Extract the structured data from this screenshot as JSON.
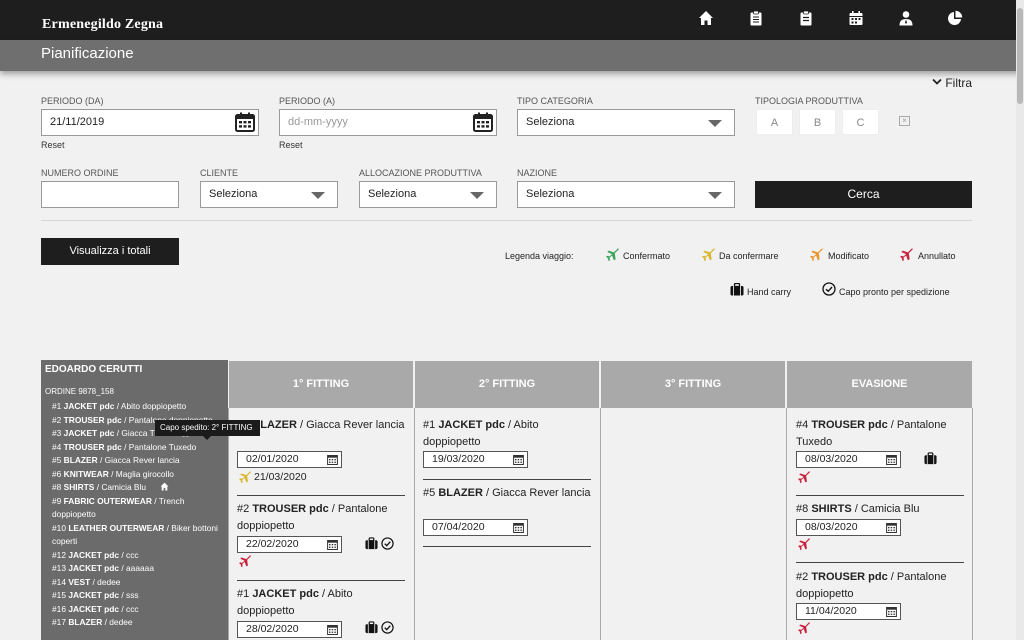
{
  "app": {
    "brand": "Ermenegildo Zegna",
    "page_title": "Pianificazione"
  },
  "nav_icons": [
    "home-icon",
    "clipboard-icon",
    "clipboard-list-icon",
    "calendar-icon",
    "user-icon",
    "pie-chart-icon"
  ],
  "filters": {
    "toggle_label": "Filtra",
    "periodo_da": {
      "label": "PERIODO (DA)",
      "value": "21/11/2019",
      "reset": "Reset"
    },
    "periodo_a": {
      "label": "PERIODO (A)",
      "placeholder": "dd-mm-yyyy",
      "reset": "Reset"
    },
    "tipo_categoria": {
      "label": "TIPO CATEGORIA",
      "value": "Seleziona"
    },
    "tipologia": {
      "label": "TIPOLOGIA PRODUTTIVA",
      "options": [
        "A",
        "B",
        "C"
      ],
      "clear": "×"
    },
    "numero_ordine": {
      "label": "NUMERO ORDINE",
      "value": ""
    },
    "cliente": {
      "label": "CLIENTE",
      "value": "Seleziona"
    },
    "allocazione": {
      "label": "ALLOCAZIONE PRODUTTIVA",
      "value": "Seleziona"
    },
    "nazione": {
      "label": "NAZIONE",
      "value": "Seleziona"
    },
    "search_label": "Cerca"
  },
  "totali_label": "Visualizza i totali",
  "legend": {
    "title": "Legenda viaggio:",
    "items": [
      {
        "label": "Confermato",
        "color": "#3aa35a"
      },
      {
        "label": "Da confermare",
        "color": "#d9b52a"
      },
      {
        "label": "Modificato",
        "color": "#e8962a"
      },
      {
        "label": "Annullato",
        "color": "#c8203a"
      }
    ],
    "hand_carry": "Hand carry",
    "capo_pronto": "Capo pronto per spedizione"
  },
  "client": {
    "name": "EDOARDO CERUTTI",
    "order": "ORDINE 9878_158",
    "items": [
      {
        "code": "#1",
        "name": "JACKET pdc",
        "desc": " / Abito doppiopetto"
      },
      {
        "code": "#2",
        "name": "TROUSER pdc",
        "desc": " / Pantalone doppiopetto"
      },
      {
        "code": "#3",
        "name": "JACKET pdc",
        "desc": " / Giacca Tuxedo"
      },
      {
        "code": "#4",
        "name": "TROUSER pdc",
        "desc": " / Pantalone Tuxedo"
      },
      {
        "code": "#5",
        "name": "BLAZER",
        "desc": " / Giacca Rever lancia"
      },
      {
        "code": "#6",
        "name": "KNITWEAR",
        "desc": " / Maglia girocollo"
      },
      {
        "code": "#8",
        "name": "SHIRTS",
        "desc": " / Camicia Blu"
      },
      {
        "code": "#9",
        "name": "FABRIC OUTERWEAR",
        "desc": " / Trench doppiopetto"
      },
      {
        "code": "#10",
        "name": "LEATHER OUTERWEAR",
        "desc": " / Biker bottoni coperti"
      },
      {
        "code": "#12",
        "name": "JACKET pdc",
        "desc": " / ccc"
      },
      {
        "code": "#13",
        "name": "JACKET pdc",
        "desc": " / aaaaaa"
      },
      {
        "code": "#14",
        "name": "VEST",
        "desc": " / dedee"
      },
      {
        "code": "#15",
        "name": "JACKET pdc",
        "desc": " / sss"
      },
      {
        "code": "#16",
        "name": "JACKET pdc",
        "desc": " / ccc"
      },
      {
        "code": "#17",
        "name": "BLAZER",
        "desc": " / dedee"
      }
    ],
    "tooltip": "Capo spedito: 2° FITTING"
  },
  "columns": [
    {
      "title": "1° FITTING",
      "cards": [
        {
          "code": "#5",
          "name": "BLAZER",
          "desc": " / Giacca Rever lancia",
          "date": "02/01/2020",
          "travel_date": "21/03/2020"
        },
        {
          "code": "#2",
          "name": "TROUSER pdc",
          "desc": " / Pantalone doppiopetto",
          "date": "22/02/2020"
        },
        {
          "code": "#1",
          "name": "JACKET pdc",
          "desc": " / Abito doppiopetto",
          "date": "28/02/2020"
        }
      ]
    },
    {
      "title": "2° FITTING",
      "cards": [
        {
          "code": "#1",
          "name": "JACKET pdc",
          "desc": " / Abito doppiopetto",
          "date": "19/03/2020"
        },
        {
          "code": "#5",
          "name": "BLAZER",
          "desc": " / Giacca Rever lancia",
          "date": "07/04/2020"
        }
      ]
    },
    {
      "title": "3° FITTING",
      "cards": []
    },
    {
      "title": "EVASIONE",
      "cards": [
        {
          "code": "#4",
          "name": "TROUSER pdc",
          "desc": " / Pantalone Tuxedo",
          "date": "08/03/2020"
        },
        {
          "code": "#8",
          "name": "SHIRTS",
          "desc": " / Camicia Blu",
          "date": "08/03/2020"
        },
        {
          "code": "#2",
          "name": "TROUSER pdc",
          "desc": " / Pantalone doppiopetto",
          "date": "11/04/2020"
        }
      ]
    }
  ]
}
